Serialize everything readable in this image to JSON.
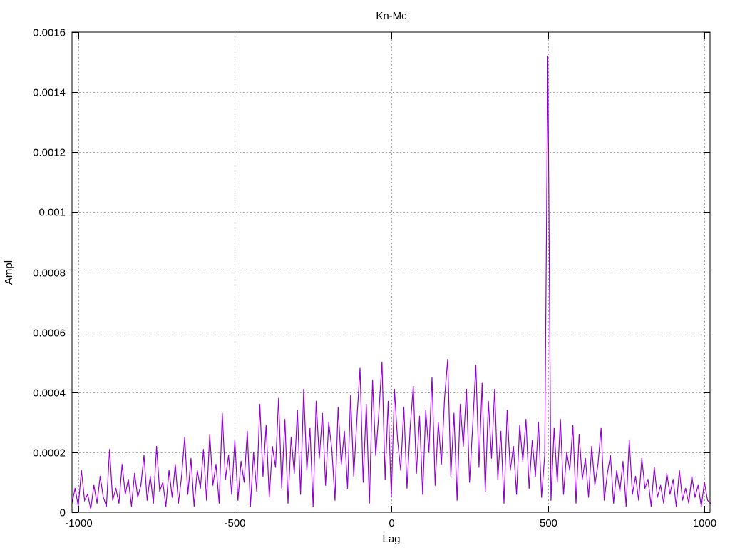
{
  "chart_data": {
    "type": "line",
    "title": "Kn-Mc",
    "xlabel": "Lag",
    "ylabel": "Ampl",
    "xlim": [
      -1020,
      1018
    ],
    "ylim": [
      0,
      0.0016
    ],
    "grid": true,
    "xticks": [
      -1000,
      -500,
      0,
      500,
      1000
    ],
    "xtick_labels": [
      "-1000",
      "-500",
      "0",
      "500",
      "1000"
    ],
    "yticks": [
      0,
      0.0002,
      0.0004,
      0.0006,
      0.0008,
      0.001,
      0.0012,
      0.0014,
      0.0016
    ],
    "ytick_labels": [
      "0",
      "0.0002",
      "0.0004",
      "0.0006",
      "0.0008",
      "0.001",
      "0.0012",
      "0.0014",
      "0.0016"
    ],
    "series": [
      {
        "name": "Kn-Mc",
        "color": "#9400d3",
        "x_start": -1020,
        "x_step": 10,
        "values": [
          3e-05,
          8e-05,
          2e-05,
          0.00014,
          4e-05,
          6e-05,
          1e-05,
          9e-05,
          3e-05,
          0.00012,
          5e-05,
          2e-05,
          0.00021,
          4e-05,
          8e-05,
          3e-05,
          0.00016,
          6e-05,
          0.00011,
          2e-05,
          0.00013,
          5e-05,
          9e-05,
          0.00019,
          4e-05,
          0.00012,
          3e-05,
          0.00022,
          7e-05,
          0.0001,
          2e-05,
          0.00014,
          5e-05,
          0.00016,
          3e-05,
          0.00012,
          0.00025,
          6e-05,
          0.00018,
          2e-05,
          0.00014,
          8e-05,
          0.00021,
          4e-05,
          0.00026,
          9e-05,
          0.00016,
          3e-05,
          0.00033,
          0.00011,
          0.00019,
          6e-05,
          0.00024,
          4e-05,
          0.00017,
          0.0001,
          0.00027,
          2e-05,
          0.0002,
          7e-05,
          0.00036,
          0.00012,
          0.00029,
          5e-05,
          0.00022,
          0.00015,
          0.00038,
          8e-05,
          0.00031,
          3e-05,
          0.00025,
          0.00013,
          0.00034,
          6e-05,
          0.00041,
          0.00014,
          0.00028,
          2e-05,
          0.00037,
          0.00018,
          0.00033,
          9e-05,
          0.0003,
          0.00021,
          4e-05,
          0.00035,
          0.00016,
          0.00027,
          8e-05,
          0.00039,
          0.00012,
          0.00031,
          0.00048,
          0.0001,
          0.00036,
          3e-05,
          0.00044,
          0.00019,
          0.00033,
          0.0005,
          0.00011,
          0.00037,
          5e-05,
          0.00041,
          0.00024,
          0.00014,
          0.00035,
          8e-05,
          0.00028,
          0.00042,
          0.00013,
          0.00032,
          6e-05,
          0.00034,
          0.0002,
          0.00045,
          9e-05,
          0.0003,
          0.00016,
          0.00038,
          0.00051,
          0.00012,
          0.00033,
          4e-05,
          0.00036,
          0.00022,
          0.00041,
          0.0001,
          0.00029,
          0.00049,
          0.00015,
          0.00043,
          7e-05,
          0.00037,
          0.00018,
          0.00041,
          0.00011,
          0.00027,
          3e-05,
          0.00034,
          0.00014,
          0.00022,
          6e-05,
          0.00029,
          0.00017,
          0.00031,
          8e-05,
          0.00024,
          0.00012,
          0.0003,
          5e-05,
          0.00019,
          0.00152,
          4e-05,
          0.00028,
          0.0001,
          0.00031,
          6e-05,
          0.0002,
          0.00014,
          0.00029,
          3e-05,
          0.00026,
          0.00011,
          0.00018,
          5e-05,
          0.00022,
          9e-05,
          0.00016,
          0.00028,
          4e-05,
          0.00013,
          0.00019,
          3e-05,
          0.00014,
          7e-05,
          0.00017,
          2e-05,
          0.00024,
          6e-05,
          0.00012,
          4e-05,
          0.00018,
          8e-05,
          0.00011,
          2e-05,
          0.00015,
          5e-05,
          9e-05,
          3e-05,
          0.00013,
          6e-05,
          0.00011,
          2e-05,
          0.00014,
          4e-05,
          8e-05,
          3e-05,
          0.00012,
          5e-05,
          9e-05,
          2e-05,
          0.0001,
          4e-05,
          3e-05
        ]
      }
    ]
  }
}
